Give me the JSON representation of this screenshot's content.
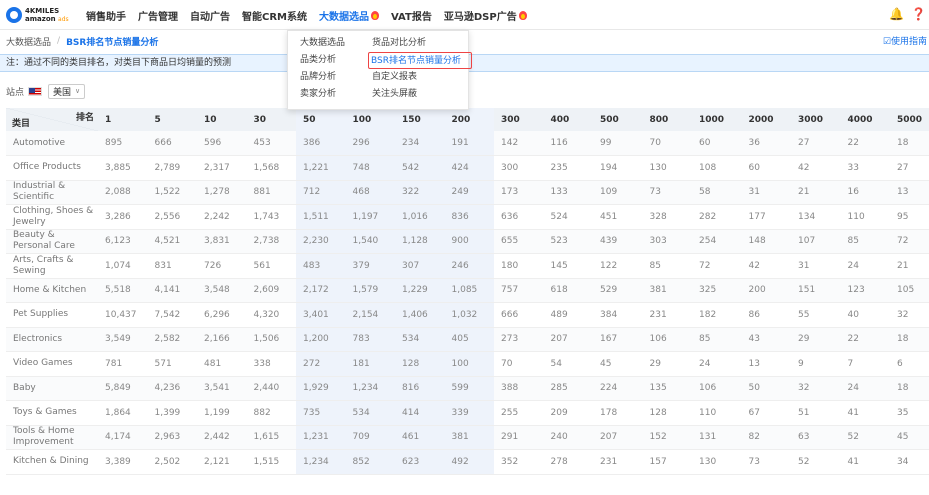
{
  "logo": {
    "line1": "4KMILES",
    "line2": "amazon",
    "line2_sub": "ads"
  },
  "nav": {
    "items": [
      {
        "label": "销售助手",
        "active": false,
        "hot": false
      },
      {
        "label": "广告管理",
        "active": false,
        "hot": false
      },
      {
        "label": "自动广告",
        "active": false,
        "hot": false
      },
      {
        "label": "智能CRM系统",
        "active": false,
        "hot": false
      },
      {
        "label": "大数据选品",
        "active": true,
        "hot": true
      },
      {
        "label": "VAT报告",
        "active": false,
        "hot": false
      },
      {
        "label": "亚马逊DSP广告",
        "active": false,
        "hot": true
      }
    ],
    "right_icons": [
      "notification-icon",
      "help-icon"
    ]
  },
  "breadcrumb": {
    "root": "大数据选品",
    "sep": "/",
    "current": "BSR排名节点销量分析"
  },
  "guide": {
    "label": "☑使用指南"
  },
  "notice": {
    "text": "注：通过不同的类目排名，对类目下商品日均销量的预测"
  },
  "site": {
    "label": "站点",
    "selected": "美国"
  },
  "dropdown": {
    "col1": [
      "大数据选品",
      "品类分析",
      "品牌分析",
      "卖家分析"
    ],
    "col2": [
      "货品对比分析",
      "BSR排名节点销量分析",
      "自定义报表",
      "关注头屏蔽"
    ],
    "selected": "BSR排名节点销量分析"
  },
  "table": {
    "corner_category": "类目",
    "corner_rank": "排名",
    "ranks": [
      "1",
      "5",
      "10",
      "30",
      "50",
      "100",
      "150",
      "200",
      "300",
      "400",
      "500",
      "800",
      "1000",
      "2000",
      "3000",
      "4000",
      "5000"
    ],
    "rows": [
      {
        "category": "Automotive",
        "values": [
          "895",
          "666",
          "596",
          "453",
          "386",
          "296",
          "234",
          "191",
          "142",
          "116",
          "99",
          "70",
          "60",
          "36",
          "27",
          "22",
          "18"
        ]
      },
      {
        "category": "Office Products",
        "values": [
          "3,885",
          "2,789",
          "2,317",
          "1,568",
          "1,221",
          "748",
          "542",
          "424",
          "300",
          "235",
          "194",
          "130",
          "108",
          "60",
          "42",
          "33",
          "27"
        ]
      },
      {
        "category": "Industrial & Scientific",
        "values": [
          "2,088",
          "1,522",
          "1,278",
          "881",
          "712",
          "468",
          "322",
          "249",
          "173",
          "133",
          "109",
          "73",
          "58",
          "31",
          "21",
          "16",
          "13"
        ]
      },
      {
        "category": "Clothing, Shoes & Jewelry",
        "values": [
          "3,286",
          "2,556",
          "2,242",
          "1,743",
          "1,511",
          "1,197",
          "1,016",
          "836",
          "636",
          "524",
          "451",
          "328",
          "282",
          "177",
          "134",
          "110",
          "95"
        ]
      },
      {
        "category": "Beauty & Personal Care",
        "values": [
          "6,123",
          "4,521",
          "3,831",
          "2,738",
          "2,230",
          "1,540",
          "1,128",
          "900",
          "655",
          "523",
          "439",
          "303",
          "254",
          "148",
          "107",
          "85",
          "72"
        ]
      },
      {
        "category": "Arts, Crafts & Sewing",
        "values": [
          "1,074",
          "831",
          "726",
          "561",
          "483",
          "379",
          "307",
          "246",
          "180",
          "145",
          "122",
          "85",
          "72",
          "42",
          "31",
          "24",
          "21"
        ]
      },
      {
        "category": "Home & Kitchen",
        "values": [
          "5,518",
          "4,141",
          "3,548",
          "2,609",
          "2,172",
          "1,579",
          "1,229",
          "1,085",
          "757",
          "618",
          "529",
          "381",
          "325",
          "200",
          "151",
          "123",
          "105"
        ]
      },
      {
        "category": "Pet Supplies",
        "values": [
          "10,437",
          "7,542",
          "6,296",
          "4,320",
          "3,401",
          "2,154",
          "1,406",
          "1,032",
          "666",
          "489",
          "384",
          "231",
          "182",
          "86",
          "55",
          "40",
          "32"
        ]
      },
      {
        "category": "Electronics",
        "values": [
          "3,549",
          "2,582",
          "2,166",
          "1,506",
          "1,200",
          "783",
          "534",
          "405",
          "273",
          "207",
          "167",
          "106",
          "85",
          "43",
          "29",
          "22",
          "18"
        ]
      },
      {
        "category": "Video Games",
        "values": [
          "781",
          "571",
          "481",
          "338",
          "272",
          "181",
          "128",
          "100",
          "70",
          "54",
          "45",
          "29",
          "24",
          "13",
          "9",
          "7",
          "6"
        ]
      },
      {
        "category": "Baby",
        "values": [
          "5,849",
          "4,236",
          "3,541",
          "2,440",
          "1,929",
          "1,234",
          "816",
          "599",
          "388",
          "285",
          "224",
          "135",
          "106",
          "50",
          "32",
          "24",
          "18"
        ]
      },
      {
        "category": "Toys & Games",
        "values": [
          "1,864",
          "1,399",
          "1,199",
          "882",
          "735",
          "534",
          "414",
          "339",
          "255",
          "209",
          "178",
          "128",
          "110",
          "67",
          "51",
          "41",
          "35"
        ]
      },
      {
        "category": "Tools & Home Improvement",
        "values": [
          "4,174",
          "2,963",
          "2,442",
          "1,615",
          "1,231",
          "709",
          "461",
          "381",
          "291",
          "240",
          "207",
          "152",
          "131",
          "82",
          "63",
          "52",
          "45"
        ]
      },
      {
        "category": "Kitchen & Dining",
        "values": [
          "3,389",
          "2,502",
          "2,121",
          "1,515",
          "1,234",
          "852",
          "623",
          "492",
          "352",
          "278",
          "231",
          "157",
          "130",
          "73",
          "52",
          "41",
          "34"
        ]
      }
    ]
  }
}
